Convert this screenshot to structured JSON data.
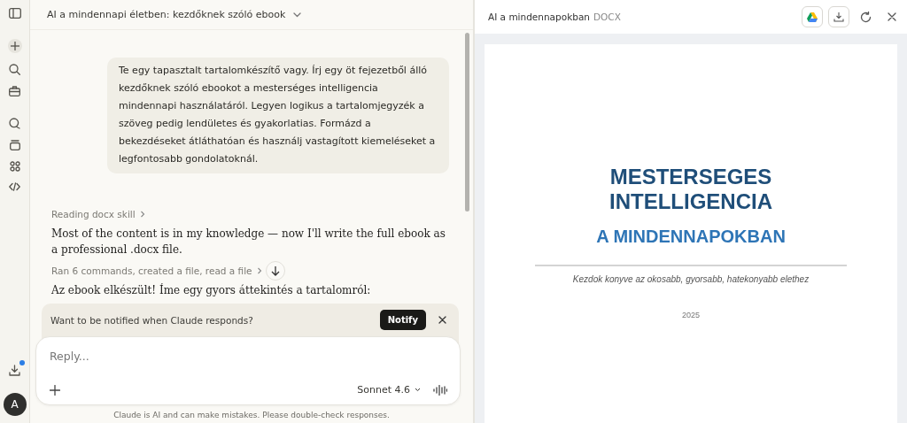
{
  "chat": {
    "title": "AI a mindennapi életben: kezdőknek szóló ebook",
    "user_message": "Te egy tapasztalt tartalomkészítő vagy. Írj egy öt fejezetből álló kezdőknek szóló ebookot a mesterséges intelligencia mindennapi használatáról. Legyen logikus a tartalomjegyzék a szöveg pedig lendületes és gyakorlatias. Formázd a bekezdéseket átláthatóan és használj vastagított kiemeléseket a legfontosabb gondolatoknál.",
    "steps": [
      {
        "kind": "tool",
        "text": "Reading docx skill"
      },
      {
        "kind": "prose",
        "text": "Most of the content is in my knowledge — now I'll write the full ebook as a professional .docx file."
      },
      {
        "kind": "tool",
        "text": "Ran 6 commands, created a file, read a file"
      },
      {
        "kind": "prose",
        "text": "Az ebook elkészült! Íme egy gyors áttekintés a tartalomról:"
      }
    ],
    "notice": {
      "text": "Want to be notified when Claude responds?",
      "button": "Notify"
    },
    "composer": {
      "placeholder": "Reply...",
      "model": "Sonnet 4.6"
    },
    "disclaimer": "Claude is AI and can make mistakes. Please double-check responses."
  },
  "sidebar": {
    "avatar": "A",
    "download_badge": true
  },
  "preview": {
    "title": "AI a mindennapokban",
    "file_type": "DOCX",
    "document": {
      "title_lines": [
        "MESTERSEGES",
        "INTELLIGENCIA"
      ],
      "subtitle": "A MINDENNAPOKBAN",
      "tagline": "Kezdok konyve az okosabb, gyorsabb, hatekonyabb elethez",
      "year": "2025"
    }
  }
}
